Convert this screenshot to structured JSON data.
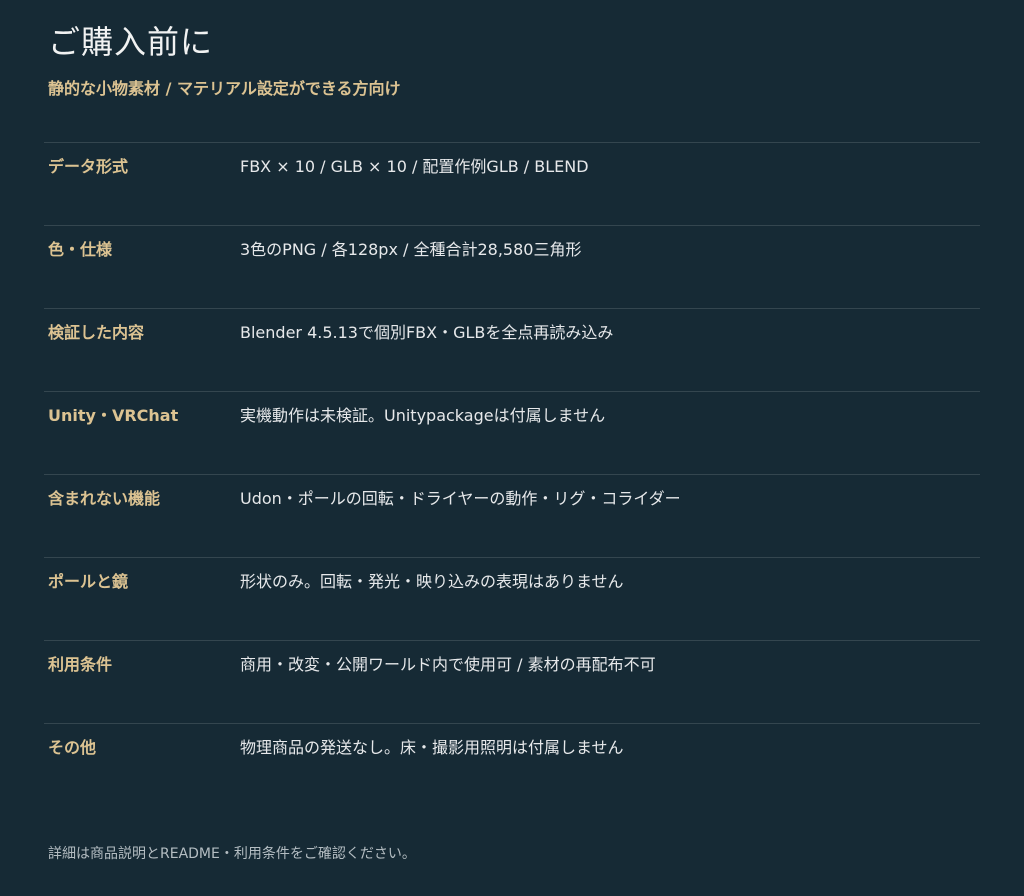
{
  "page": {
    "title": "ご購入前に",
    "subtitle": "静的な小物素材 / マテリアル設定ができる方向け"
  },
  "specs": [
    {
      "label": "データ形式",
      "value": "FBX × 10 / GLB × 10 / 配置作例GLB / BLEND"
    },
    {
      "label": "色・仕様",
      "value": "3色のPNG / 各128px / 全種合計28,580三角形"
    },
    {
      "label": "検証した内容",
      "value": "Blender 4.5.13で個別FBX・GLBを全点再読み込み"
    },
    {
      "label": "Unity・VRChat",
      "value": "実機動作は未検証。Unitypackageは付属しません"
    },
    {
      "label": "含まれない機能",
      "value": "Udon・ポールの回転・ドライヤーの動作・リグ・コライダー"
    },
    {
      "label": "ポールと鏡",
      "value": "形状のみ。回転・発光・映り込みの表現はありません"
    },
    {
      "label": "利用条件",
      "value": "商用・改変・公開ワールド内で使用可 / 素材の再配布不可"
    },
    {
      "label": "その他",
      "value": "物理商品の発送なし。床・撮影用照明は付属しません"
    }
  ],
  "footer": {
    "note": "詳細は商品説明とREADME・利用条件をご確認ください。"
  },
  "colors": {
    "background": "#162a35",
    "accent_gold": "#dcc392",
    "text_primary": "#e6e8ea",
    "divider": "#34464f"
  }
}
